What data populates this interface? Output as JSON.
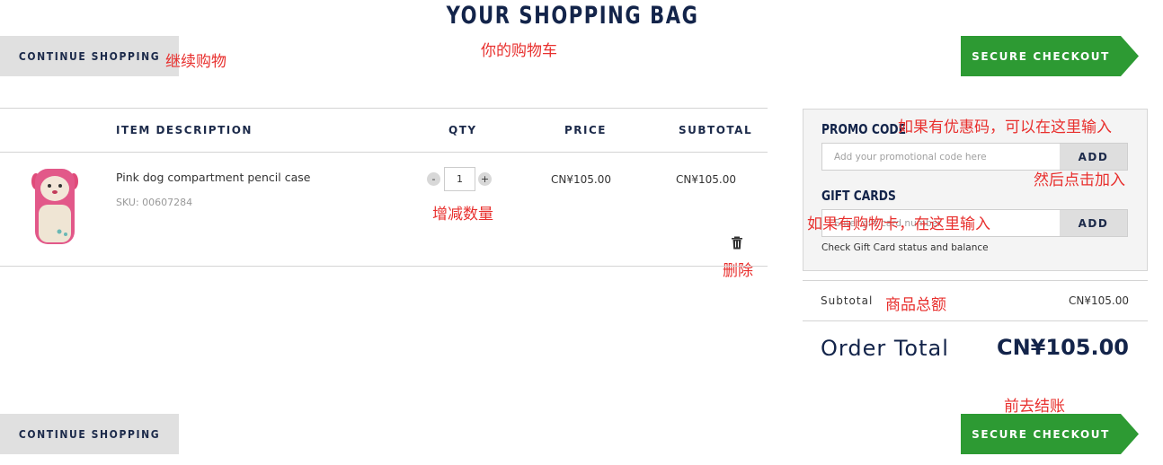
{
  "page_title": "YOUR SHOPPING BAG",
  "buttons": {
    "continue_shopping": "CONTINUE SHOPPING",
    "secure_checkout": "SECURE CHECKOUT"
  },
  "table": {
    "headers": [
      "ITEM DESCRIPTION",
      "QTY",
      "PRICE",
      "SUBTOTAL"
    ],
    "items": [
      {
        "name": "Pink dog compartment pencil case",
        "sku": "SKU: 00607284",
        "qty": "1",
        "qty_minus": "-",
        "qty_plus": "+",
        "price": "CN¥105.00",
        "subtotal": "CN¥105.00"
      }
    ]
  },
  "promo": {
    "label": "PROMO CODE",
    "placeholder": "Add your promotional code here",
    "add_label": "ADD"
  },
  "gift": {
    "label": "GIFT CARDS",
    "placeholder": "Enter gift card number",
    "add_label": "ADD",
    "check_link": "Check Gift Card status and balance"
  },
  "summary": {
    "subtotal_label": "Subtotal",
    "subtotal_value": "CN¥105.00",
    "order_total_label": "Order Total",
    "order_total_value": "CN¥105.00"
  },
  "annotations": {
    "continue": "继续购物",
    "cart": "你的购物车",
    "qty": "增减数量",
    "delete": "删除",
    "promo": "如果有优惠码，可以在这里输入",
    "promo_add": "然后点击加入",
    "gift": "如果有购物卡，在这里输入",
    "subtotal": "商品总额",
    "checkout": "前去结账"
  },
  "icons": {
    "delete": "trash-icon",
    "product": "pink-dog-pencil-case-image"
  },
  "colors": {
    "checkout_green": "#2d9a33",
    "navy": "#13244a",
    "annotation_red": "#e8302e",
    "button_grey": "#e0e0e0"
  }
}
